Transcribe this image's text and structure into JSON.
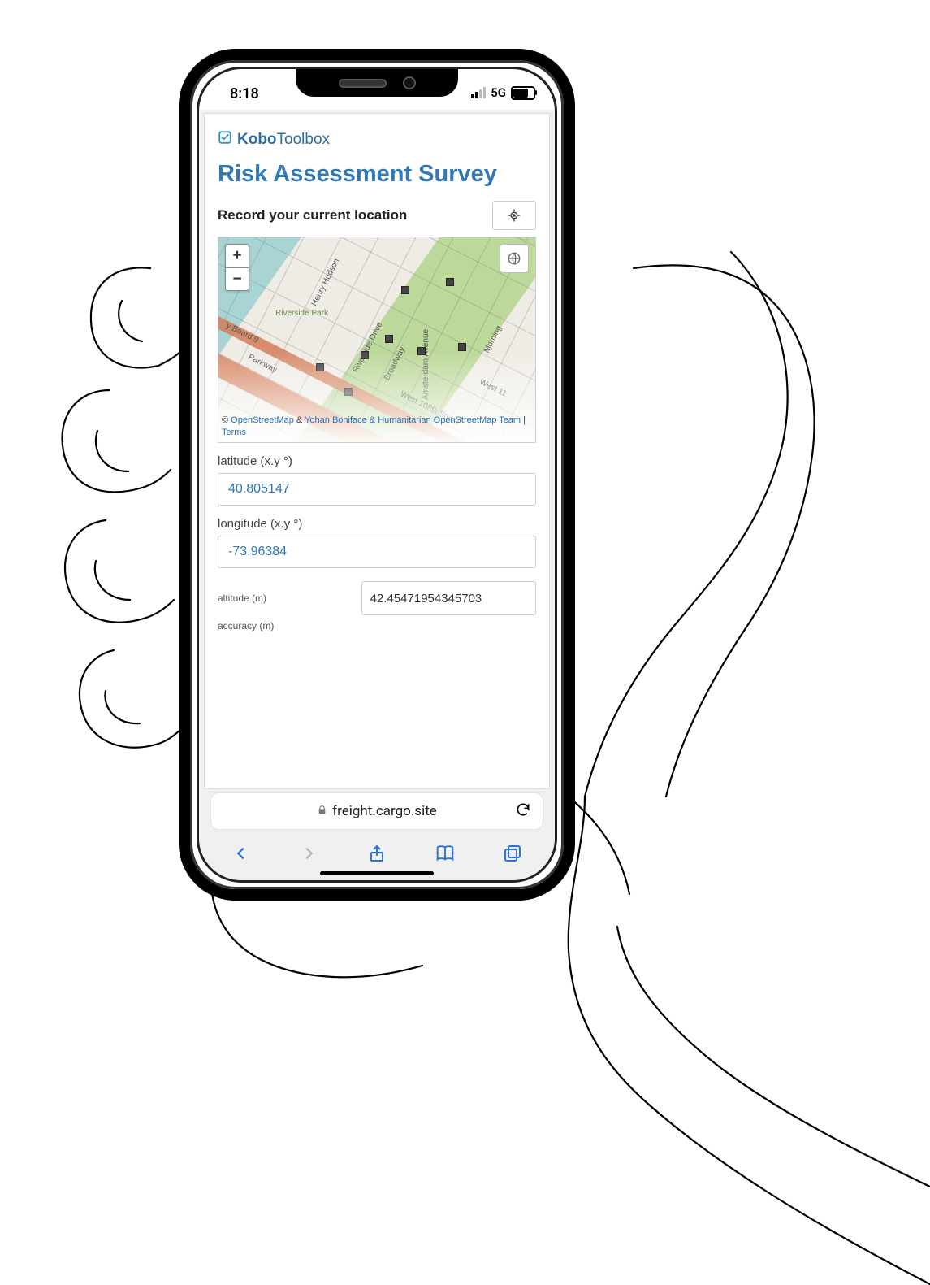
{
  "status": {
    "time": "8:18",
    "network_label": "5G"
  },
  "content": {
    "brand_prefix": "Kobo",
    "brand_suffix": "Toolbox",
    "title": "Risk Assessment Survey",
    "instruction": "Record your current location",
    "map": {
      "zoom_in": "+",
      "zoom_out": "−",
      "streets": {
        "henry_hudson": "Henry Hudson",
        "riverside_drive": "Riverside Drive",
        "riverside_park": "Riverside Park",
        "broadway": "Broadway",
        "amsterdam": "Amsterdam Avenue",
        "w108": "West 108th Street",
        "board": "'y Board 9",
        "w11": "West 11",
        "parkway": "Parkway",
        "morning": "Morning"
      },
      "attribution": {
        "copyright": "©",
        "osm": "OpenStreetMap",
        "amp": "&",
        "yohan": "Yohan Boniface & Humanitarian OpenStreetMap Team",
        "pipe": "|",
        "terms": "Terms"
      }
    },
    "lat_label": "latitude (x.y °)",
    "lat_value": "40.805147",
    "lon_label": "longitude (x.y °)",
    "lon_value": "-73.96384",
    "alt_label": "altitude (m)",
    "alt_value": "42.45471954345703",
    "acc_label": "accuracy (m)"
  },
  "browser": {
    "domain": "freight.cargo.site"
  }
}
